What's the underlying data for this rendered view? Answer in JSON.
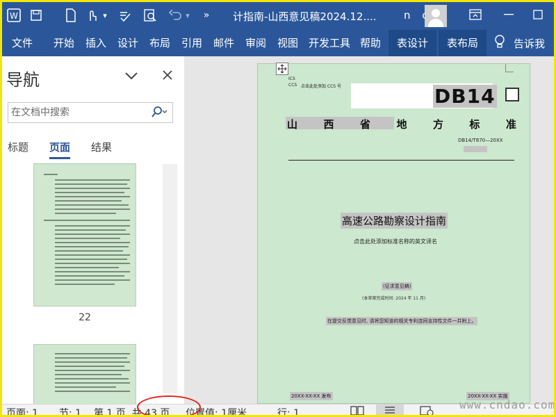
{
  "titlebar": {
    "title": "计指南-山西意见稿2024.12....",
    "user_initials": "n c",
    "qat_overflow": "»",
    "undo_caret": "▾"
  },
  "ribbon": {
    "tabs": [
      "文件",
      "开始",
      "插入",
      "设计",
      "布局",
      "引用",
      "邮件",
      "审阅",
      "视图",
      "开发工具",
      "帮助",
      "表设计",
      "表布局"
    ],
    "tell_me": "告诉我"
  },
  "nav": {
    "title": "导航",
    "search_placeholder": "在文档中搜索",
    "tabs": [
      "标题",
      "页面",
      "结果"
    ],
    "active_tab": "页面",
    "thumb_numbers": [
      "22"
    ]
  },
  "document": {
    "ics": "ICS",
    "ccs": "CCS",
    "ccs_hint": "点击此处添加 CCS 号",
    "db_label": "DB14",
    "title_chars": [
      "山",
      "西",
      "省",
      "地",
      "方",
      "标",
      "准"
    ],
    "std_number": "DB14/T870—20XX",
    "main_title": "高速公路勘察设计指南",
    "en_title_hint": "点击此处添加标准名称的英文译名",
    "draft_label": "(征求意见稿)",
    "draft_date": "(本草案完成时间: 2024 年 11 月)",
    "feedback_note": "在提交反馈意见时, 请将您知道的相关专利连同支持性文件一并附上。",
    "publish_left": "20XX-XX-XX 发布",
    "publish_right": "20XX-XX-XX 实施"
  },
  "statusbar": {
    "page": "页面: 1",
    "section": "节: 1",
    "page_of": "第 1 页, 共 43 页",
    "position": "位置值: 1厘米",
    "line": "行: 1"
  },
  "watermark": "www.cndao.com",
  "colors": {
    "brand": "#2b579a",
    "page_green": "#cce8cf",
    "highlight": "#c4c4c4",
    "annotation_red": "#e2241b",
    "frame_yellow": "#f3e600"
  }
}
